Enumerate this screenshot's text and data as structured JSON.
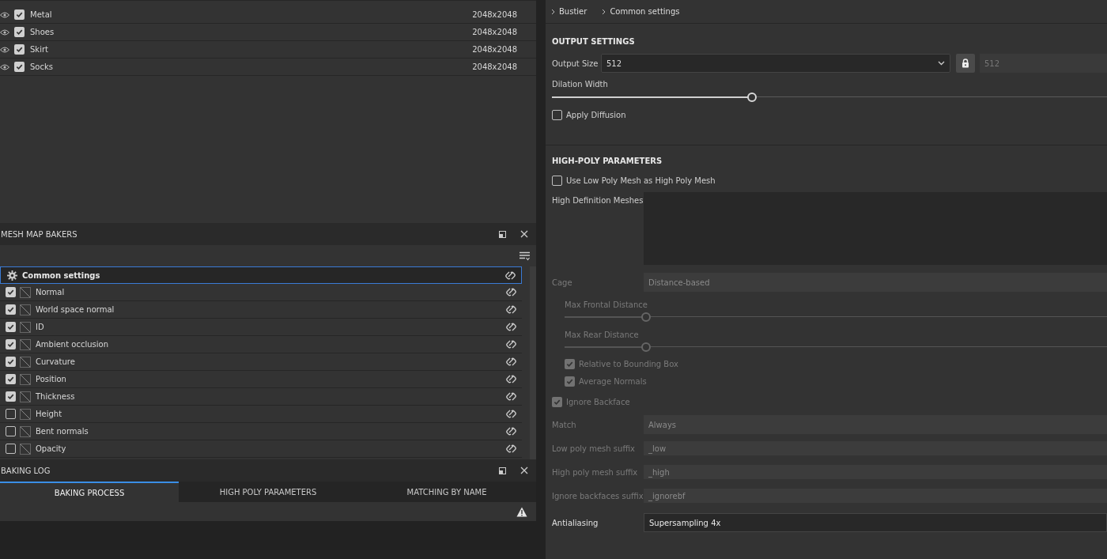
{
  "texture_sets": [
    {
      "name": "Metal",
      "resolution": "2048x2048",
      "visible": true,
      "checked": true
    },
    {
      "name": "Shoes",
      "resolution": "2048x2048",
      "visible": true,
      "checked": true
    },
    {
      "name": "Skirt",
      "resolution": "2048x2048",
      "visible": true,
      "checked": true
    },
    {
      "name": "Socks",
      "resolution": "2048x2048",
      "visible": true,
      "checked": true
    }
  ],
  "mesh_map_bakers": {
    "title": "MESH MAP BAKERS",
    "items": [
      {
        "kind": "settings",
        "label": "Common settings",
        "selected": true
      },
      {
        "kind": "baker",
        "label": "Normal",
        "checked": true,
        "selected": false
      },
      {
        "kind": "baker",
        "label": "World space normal",
        "checked": true,
        "selected": false
      },
      {
        "kind": "baker",
        "label": "ID",
        "checked": true,
        "selected": false
      },
      {
        "kind": "baker",
        "label": "Ambient occlusion",
        "checked": true,
        "selected": false
      },
      {
        "kind": "baker",
        "label": "Curvature",
        "checked": true,
        "selected": false
      },
      {
        "kind": "baker",
        "label": "Position",
        "checked": true,
        "selected": false
      },
      {
        "kind": "baker",
        "label": "Thickness",
        "checked": true,
        "selected": false
      },
      {
        "kind": "baker",
        "label": "Height",
        "checked": false,
        "selected": false
      },
      {
        "kind": "baker",
        "label": "Bent normals",
        "checked": false,
        "selected": false
      },
      {
        "kind": "baker",
        "label": "Opacity",
        "checked": false,
        "selected": false
      }
    ]
  },
  "baking_log": {
    "title": "BAKING LOG",
    "tabs": [
      {
        "label": "BAKING PROCESS",
        "selected": true
      },
      {
        "label": "HIGH POLY PARAMETERS",
        "selected": false
      },
      {
        "label": "MATCHING BY NAME",
        "selected": false
      }
    ]
  },
  "breadcrumb": [
    "Bustier",
    "Common settings"
  ],
  "output_settings": {
    "title": "OUTPUT SETTINGS",
    "output_size": {
      "label": "Output Size",
      "value": "512",
      "locked_value": "512"
    },
    "dilation": {
      "label": "Dilation Width",
      "level": 0.36
    },
    "apply_diffusion": {
      "label": "Apply Diffusion",
      "checked": false
    }
  },
  "high_poly": {
    "title": "HIGH-POLY PARAMETERS",
    "use_low_poly": {
      "label": "Use Low Poly Mesh as High Poly Mesh",
      "checked": false
    },
    "meshes_label": "High Definition Meshes",
    "rows": [
      {
        "kind": "select",
        "label": "Cage",
        "value": "Distance-based",
        "disabled": true,
        "children": [
          {
            "kind": "slider",
            "label": "Max Frontal Distance",
            "level": 0.15,
            "disabled": true
          },
          {
            "kind": "slider",
            "label": "Max Rear Distance",
            "level": 0.15,
            "disabled": true
          },
          {
            "kind": "checkbox",
            "label": "Relative to Bounding Box",
            "checked": true,
            "disabled": true
          },
          {
            "kind": "checkbox",
            "label": "Average Normals",
            "checked": true,
            "disabled": true
          }
        ]
      },
      {
        "kind": "checkbox",
        "label": "Ignore Backface",
        "checked": true,
        "disabled": true
      },
      {
        "kind": "select",
        "label": "Match",
        "value": "Always",
        "disabled": true
      },
      {
        "kind": "text",
        "label": "Low poly mesh suffix",
        "value": "_low",
        "disabled": true
      },
      {
        "kind": "text",
        "label": "High poly mesh suffix",
        "value": "_high",
        "disabled": true
      },
      {
        "kind": "text",
        "label": "Ignore backfaces suffix",
        "value": "_ignorebf",
        "disabled": true
      },
      {
        "kind": "select",
        "label": "Antialiasing",
        "value": "Supersampling 4x",
        "disabled": false
      }
    ]
  }
}
